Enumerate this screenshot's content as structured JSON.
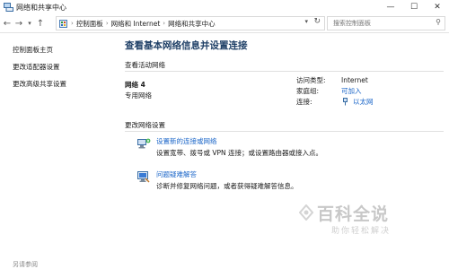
{
  "window": {
    "title": "网络和共享中心",
    "minimize": "—",
    "maximize": "☐",
    "close": "✕"
  },
  "address_bar": {
    "breadcrumbs": [
      "控制面板",
      "网络和 Internet",
      "网络和共享中心"
    ],
    "search_placeholder": "搜索控制面板"
  },
  "sidebar": {
    "items": [
      "控制面板主页",
      "更改适配器设置",
      "更改高级共享设置"
    ],
    "see_also": "另请参阅"
  },
  "main": {
    "title": "查看基本网络信息并设置连接",
    "active_networks_label": "查看活动网络",
    "network": {
      "name": "网络  4",
      "type": "专用网络",
      "access_type_label": "访问类型:",
      "access_type": "Internet",
      "homegroup_label": "家庭组:",
      "homegroup": "可加入",
      "connections_label": "连接:",
      "connection": "以太网"
    },
    "change_settings_label": "更改网络设置",
    "tasks": [
      {
        "link": "设置新的连接或网络",
        "description": "设置宽带、拨号或 VPN 连接；或设置路由器或接入点。"
      },
      {
        "link": "问题疑难解答",
        "description": "诊断并修复网络问题，或者获得疑难解答信息。"
      }
    ]
  },
  "watermark": {
    "main": "百科全说",
    "sub": "助你轻松解决"
  },
  "colors": {
    "link": "#1a65c8",
    "title": "#1e3f66"
  }
}
